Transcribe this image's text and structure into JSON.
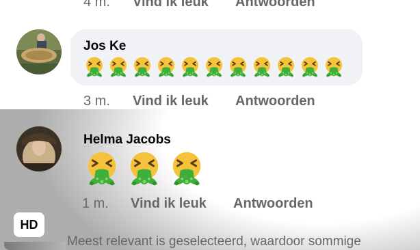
{
  "previous_comment": {
    "time": "4 m.",
    "like_label": "Vind ik leuk",
    "reply_label": "Antwoorden"
  },
  "comments": [
    {
      "author": "Jos Ke",
      "emoji_count": 11,
      "emoji_name": "vomiting-face-icon",
      "time": "3 m.",
      "like_label": "Vind ik leuk",
      "reply_label": "Antwoorden"
    },
    {
      "author": "Helma Jacobs",
      "emoji_count": 3,
      "emoji_name": "vomiting-face-icon",
      "time": "1 m.",
      "like_label": "Vind ik leuk",
      "reply_label": "Antwoorden"
    }
  ],
  "video_badge": "HD",
  "footer_notice": "Meest relevant is geselecteerd, waardoor sommige",
  "colors": {
    "bubble": "#f0f2f5",
    "meta_text": "#65676b",
    "author_text": "#050505"
  }
}
